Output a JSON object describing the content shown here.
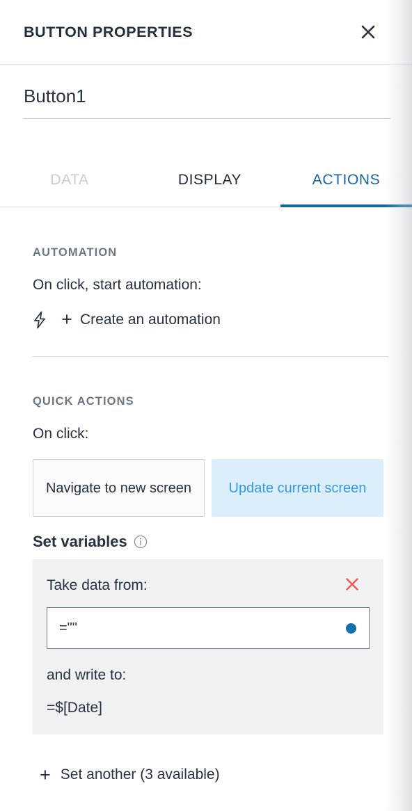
{
  "header": {
    "title": "BUTTON PROPERTIES",
    "close_icon": "close-icon"
  },
  "name_field": {
    "value": "Button1",
    "placeholder": "Button1"
  },
  "tabs": [
    {
      "label": "DATA",
      "active": false,
      "disabled": true
    },
    {
      "label": "DISPLAY",
      "active": false,
      "disabled": false
    },
    {
      "label": "ACTIONS",
      "active": true,
      "disabled": false
    }
  ],
  "automation": {
    "section_label": "AUTOMATION",
    "prompt": "On click, start automation:",
    "bolt_icon": "lightning-bolt-icon",
    "plus_icon": "+",
    "create_label": "Create an automation"
  },
  "quick_actions": {
    "section_label": "QUICK ACTIONS",
    "prompt": "On click:",
    "buttons": [
      {
        "label": "Navigate to new screen",
        "selected": false
      },
      {
        "label": "Update current screen",
        "selected": true
      }
    ]
  },
  "set_variables": {
    "title": "Set variables",
    "info_icon": "info-icon",
    "take_data_from_label": "Take data from:",
    "remove_icon": "close-x-icon",
    "input_value": "=\"\"",
    "input_placeholder": "=\"\"",
    "dot_indicator": "formula-dot-indicator",
    "write_to_label": "and write to:",
    "write_to_value": "=$[Date]",
    "set_another_plus": "+",
    "set_another_label": "Set another (3 available)"
  },
  "colors": {
    "accent_blue": "#1268a4",
    "selected_blue_text": "#3399e6",
    "selected_blue_bg": "#ddeefb",
    "dot_blue": "#1271ac",
    "remove_red": "#f4564a",
    "text_dark": "#273142",
    "muted_gray": "#6d7683",
    "disabled_gray": "#c7cbd1",
    "card_gray": "#f0f1f3"
  }
}
